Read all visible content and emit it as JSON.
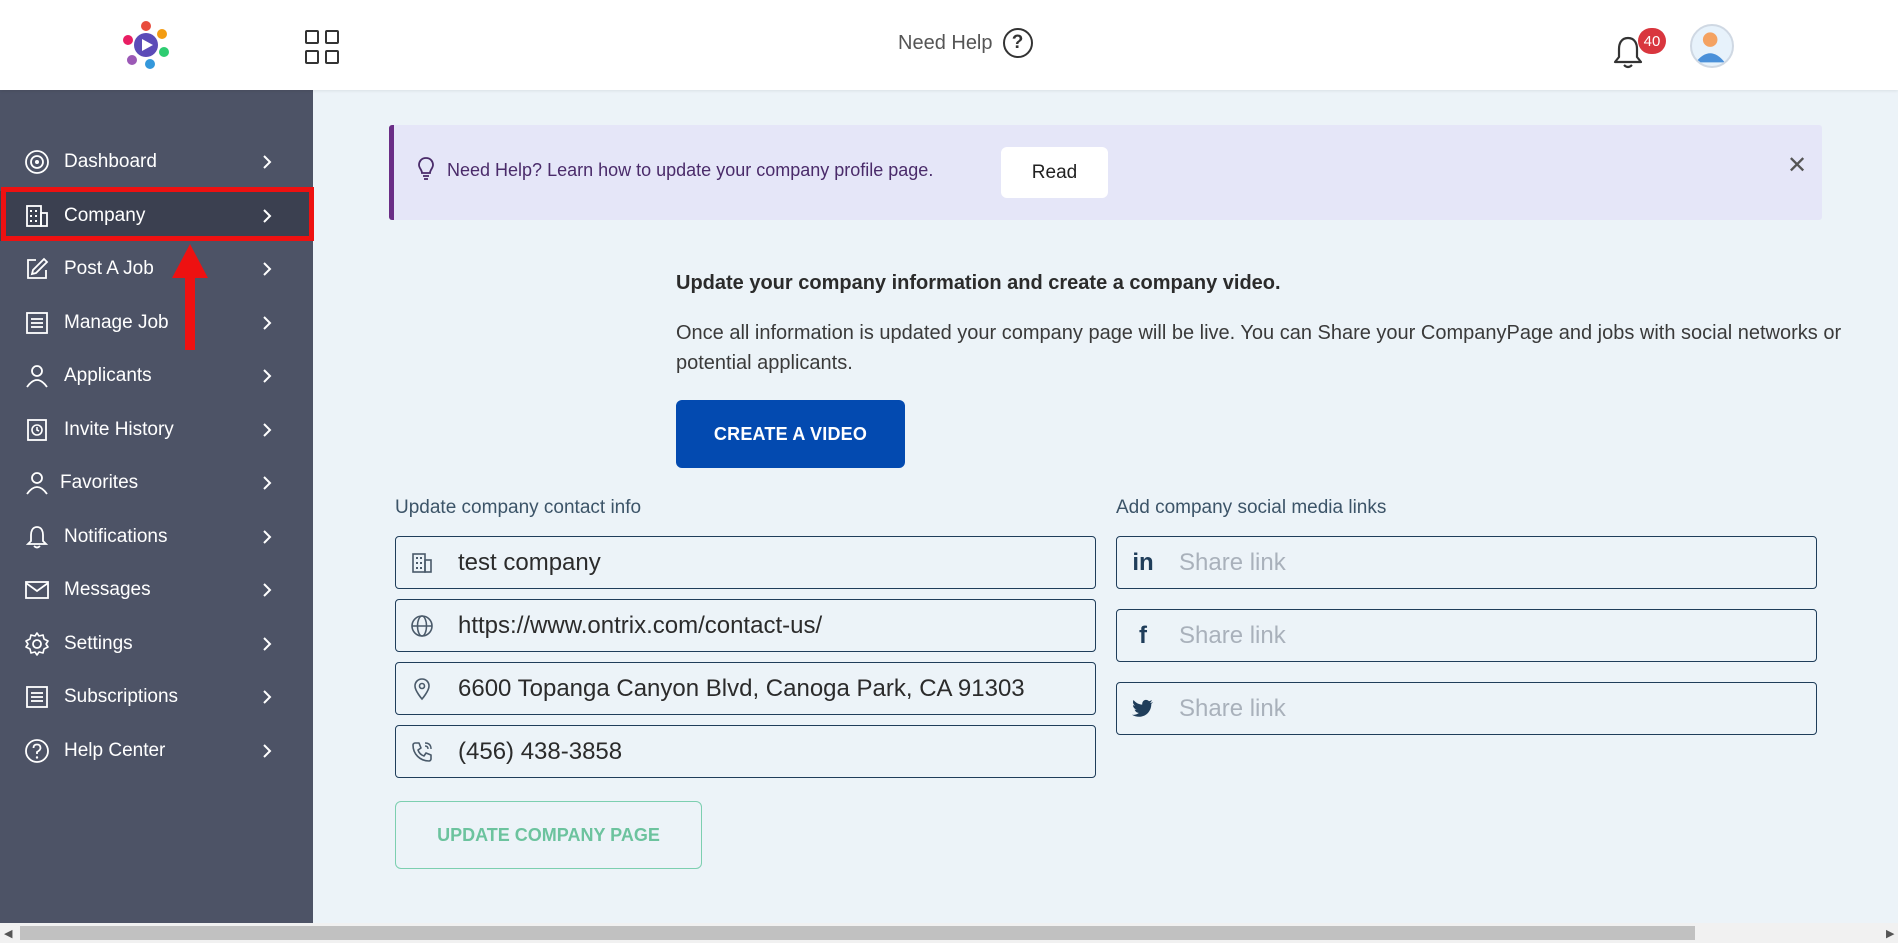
{
  "header": {
    "help_label": "Need Help",
    "help_symbol": "?",
    "notification_count": "40",
    "badge_color": "#d9363e"
  },
  "sidebar": {
    "items": [
      {
        "label": "Dashboard",
        "icon": "dashboard-icon"
      },
      {
        "label": "Company",
        "icon": "building-icon",
        "active": true
      },
      {
        "label": "Post A Job",
        "icon": "edit-icon"
      },
      {
        "label": "Manage Job",
        "icon": "list-icon"
      },
      {
        "label": "Applicants",
        "icon": "user-icon"
      },
      {
        "label": "Invite History",
        "icon": "history-icon"
      },
      {
        "label": "Favorites",
        "icon": "user-icon"
      },
      {
        "label": "Notifications",
        "icon": "bell-icon"
      },
      {
        "label": "Messages",
        "icon": "mail-icon"
      },
      {
        "label": "Settings",
        "icon": "gear-icon"
      },
      {
        "label": "Subscriptions",
        "icon": "list-icon"
      },
      {
        "label": "Help Center",
        "icon": "help-icon"
      }
    ],
    "background": "#4d5366"
  },
  "banner": {
    "text": "Need Help? Learn how to update your company profile page.",
    "read_label": "Read",
    "close_symbol": "✕"
  },
  "intro": {
    "title": "Update your company information and create a company video.",
    "line1": "Once all information is updated your company page will be live. You can Share your CompanyPage and jobs with social networks or",
    "line2": "potential applicants.",
    "create_video_label": "CREATE A VIDEO",
    "accent": "#034ab0"
  },
  "contact": {
    "heading": "Update company contact info",
    "company_name": "test company",
    "website": "https://www.ontrix.com/contact-us/",
    "address": "6600 Topanga Canyon Blvd, Canoga Park, CA 91303",
    "phone": "(456) 438-3858"
  },
  "social": {
    "heading": "Add company social media links",
    "linkedin_placeholder": "Share link",
    "facebook_placeholder": "Share link",
    "twitter_placeholder": "Share link",
    "linkedin_symbol": "in",
    "facebook_symbol": "f"
  },
  "update_button_label": "UPDATE COMPANY PAGE"
}
